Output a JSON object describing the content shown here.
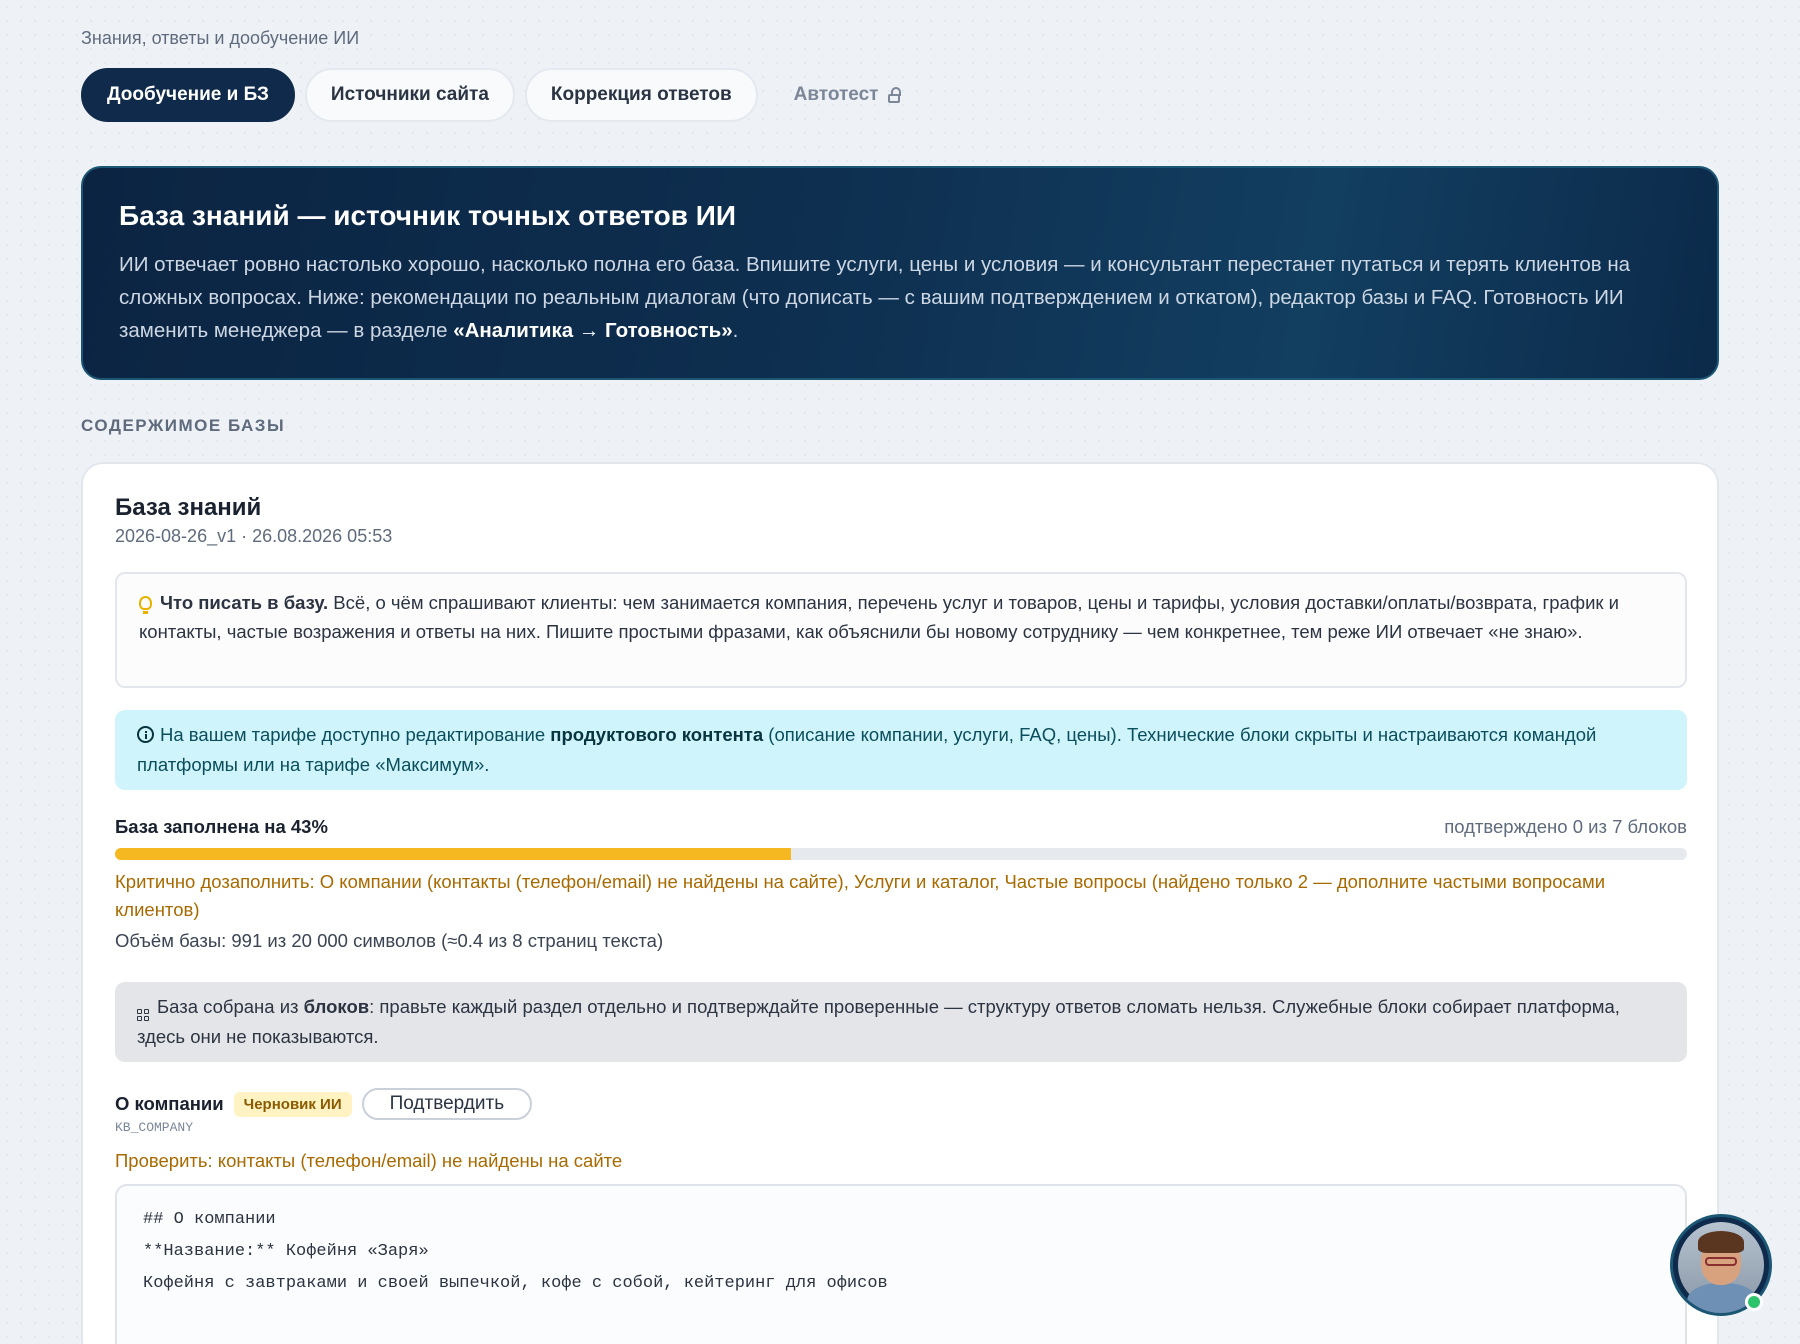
{
  "breadcrumb": "Знания, ответы и дообучение ИИ",
  "tabs": [
    {
      "label": "Дообучение и БЗ",
      "active": true
    },
    {
      "label": "Источники сайта",
      "active": false
    },
    {
      "label": "Коррекция ответов",
      "active": false
    },
    {
      "label": "Автотест",
      "locked": true
    }
  ],
  "hero": {
    "title": "База знаний — источник точных ответов ИИ",
    "text": "ИИ отвечает ровно настолько хорошо, насколько полна его база. Впишите услуги, цены и условия — и консультант перестанет путаться и терять клиентов на сложных вопросах. Ниже: рекомендации по реальным диалогам (что дописать — с вашим подтверждением и откатом), редактор базы и FAQ. Готовность ИИ заменить менеджера — в разделе ",
    "link": "«Аналитика → Готовность»",
    "tail": "."
  },
  "section_label": "СОДЕРЖИМОЕ БАЗЫ",
  "kb": {
    "title": "База знаний",
    "meta": "2026-08-26_v1 · 26.08.2026 05:53",
    "tip_bold": "Что писать в базу.",
    "tip_text": " Всё, о чём спрашивают клиенты: чем занимается компания, перечень услуг и товаров, цены и тарифы, условия доставки/оплаты/возврата, график и контакты, частые возражения и ответы на них. Пишите простыми фразами, как объяснили бы новому сотруднику — чем конкретнее, тем реже ИИ отвечает «не знаю».",
    "info_pre": "На вашем тарифе доступно редактирование ",
    "info_bold": "продуктового контента",
    "info_post": " (описание компании, услуги, FAQ, цены). Технические блоки скрыты и настраиваются командой платформы или на тарифе «Максимум».",
    "fill_label": "База заполнена на 43%",
    "fill_percent": 43,
    "confirmed": "подтверждено 0 из 7 блоков",
    "critical": "Критично дозаполнить: О компании (контакты (телефон/email) не найдены на сайте), Услуги и каталог, Частые вопросы (найдено только 2 — дополните частыми вопросами клиентов)",
    "volume": "Объём базы: 991 из 20 000 символов (≈0.4 из 8 страниц текста)",
    "blocks_pre": "База собрана из ",
    "blocks_bold": "блоков",
    "blocks_post": ": правьте каждый раздел отдельно и подтверждайте проверенные — структуру ответов сломать нельзя. Служебные блоки собирает платформа, здесь они не показываются."
  },
  "section": {
    "name": "О компании",
    "badge": "Черновик ИИ",
    "confirm_label": "Подтвердить",
    "code": "KB_COMPANY",
    "warning": "Проверить: контакты (телефон/email) не найдены на сайте",
    "editor_lines": [
      "## О компании",
      "",
      "**Название:** Кофейня «Заря»",
      "",
      "Кофейня с завтраками и своей выпечкой, кофе с собой, кейтеринг для офисов"
    ]
  },
  "colors": {
    "primary": "#0f2a4a",
    "progress": "#f5b820",
    "warning_text": "#a86a00",
    "info_bg": "#cff4fc",
    "online": "#2bc46a"
  }
}
